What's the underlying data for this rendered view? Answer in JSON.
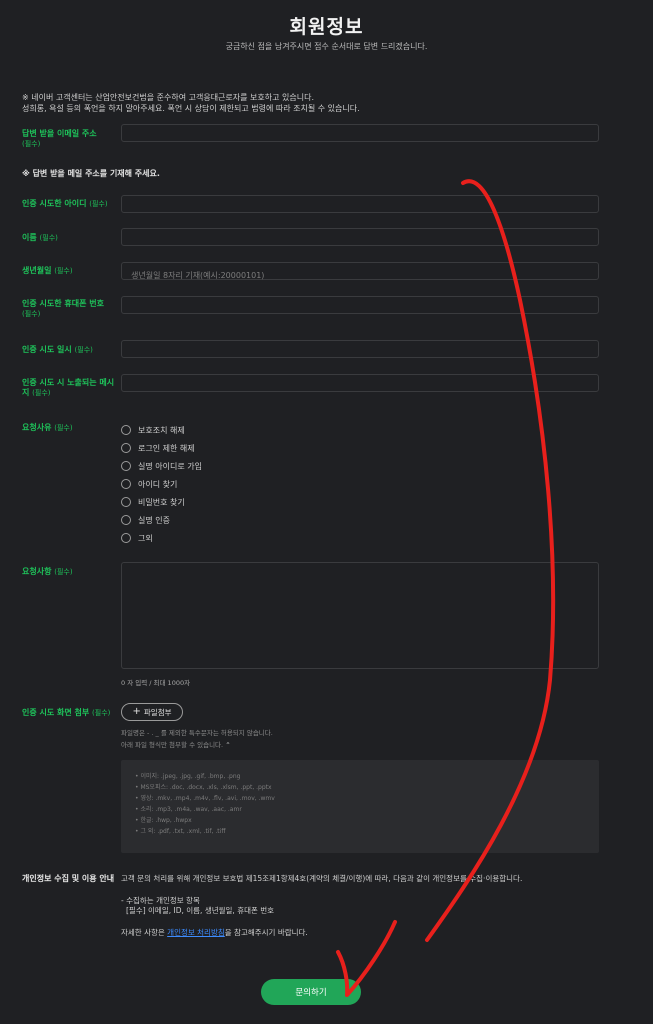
{
  "header": {
    "title": "회원정보",
    "subtitle": "궁금하신 점을 남겨주시면 접수 순서대로 답변 드리겠습니다."
  },
  "notice": {
    "line1": "※ 네이버 고객센터는 산업안전보건법을 준수하여 고객응대근로자를 보호하고 있습니다.",
    "line2": "성희롱, 욕설 등의 폭언을 하지 말아주세요. 폭언 시 상담이 제한되고 법령에 따라 조치될 수 있습니다."
  },
  "required_tag": "(필수)",
  "fields": {
    "email": {
      "label": "답변 받을 이메일 주소",
      "value": "",
      "placeholder": ""
    },
    "email_note": "※ 답변 받을 메일 주소를 기재해 주세요.",
    "user_id": {
      "label": "인증 시도한 아이디",
      "value": "",
      "placeholder": ""
    },
    "name": {
      "label": "이름",
      "value": "",
      "placeholder": ""
    },
    "birthdate": {
      "label": "생년월일",
      "value": "",
      "placeholder": "생년월일 8자리 기재(예시:20000101)"
    },
    "phone": {
      "label": "인증 시도한 휴대폰 번호",
      "value": "",
      "placeholder": ""
    },
    "attempt_time": {
      "label": "인증 시도 일시",
      "value": "",
      "placeholder": ""
    },
    "message": {
      "label": "인증 시도 시 노출되는 메시지",
      "value": "",
      "placeholder": ""
    }
  },
  "reason": {
    "label": "요청사유",
    "options": [
      "보호조치 해제",
      "로그인 제한 해제",
      "실명 아이디로 가입",
      "아이디 찾기",
      "비밀번호 찾기",
      "실명 인증",
      "그외"
    ]
  },
  "request": {
    "label": "요청사항",
    "value": "",
    "counter": "0 자 입력 / 최대 1000자"
  },
  "attachment": {
    "label": "인증 시도 화면 첨부",
    "button_icon": "plus-icon",
    "button_label": "파일첨부",
    "help_line1": "파일명은 - . _ 를 제외한 특수문자는 허용되지 않습니다.",
    "help_line2": "아래 파일 형식만 첨부할 수 있습니다.",
    "formats": [
      "• 이미지: .jpeg, .jpg, .gif, .bmp, .png",
      "• MS오피스: .doc, .docx, .xls, .xlsm, .ppt, .pptx",
      "• 영상: .mkv, .mp4, .m4v, .flv, .avi, .mov, .wmv",
      "• 소리: .mp3, .m4a, .wav, .aac, .amr",
      "• 한글: .hwp, .hwpx",
      "• 그 외: .pdf, .txt, .xml, .tif, .tiff"
    ]
  },
  "privacy": {
    "label": "개인정보 수집 및 이용 안내",
    "line1": "고객 문의 처리를 위해 개인정보 보호법 제15조제1항제4호(계약의 체결/이행)에 따라, 다음과 같이 개인정보를 수집·이용합니다.",
    "line2": "- 수집하는 개인정보 항목",
    "line3": "[필수] 이메일, ID, 이름, 생년월일, 휴대폰 번호",
    "line4_pre": "자세한 사항은 ",
    "line4_link": "개인정보 처리방침",
    "line4_post": "을 참고해주시기 바랍니다."
  },
  "submit_label": "문의하기",
  "colors": {
    "background": "#1f2023",
    "accent_green": "#1ec25a",
    "button_green": "#21a658",
    "annotation_red": "#e8201c",
    "link_blue": "#3d8cff"
  }
}
